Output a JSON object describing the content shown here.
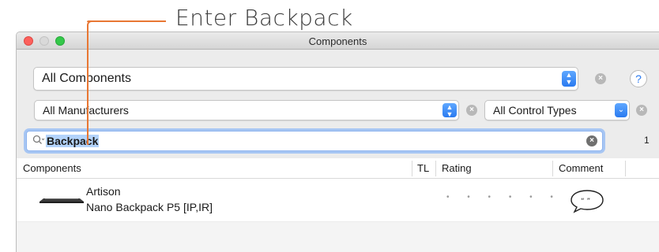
{
  "annotation": {
    "text": "Enter Backpack",
    "accent": "#e87733"
  },
  "window": {
    "title": "Components"
  },
  "filters": {
    "component_type": "All Components",
    "manufacturer": "All Manufacturers",
    "control_type": "All Control Types",
    "help_label": "?"
  },
  "search": {
    "value": "Backpack",
    "icon": "magnifier-icon",
    "result_count": "1"
  },
  "table": {
    "columns": [
      "Components",
      "TL",
      "Rating",
      "Comment"
    ],
    "rows": [
      {
        "manufacturer": "Artison",
        "model": "Nano Backpack P5 [IP,IR]",
        "rating_dots": "• • • • • •"
      }
    ]
  }
}
